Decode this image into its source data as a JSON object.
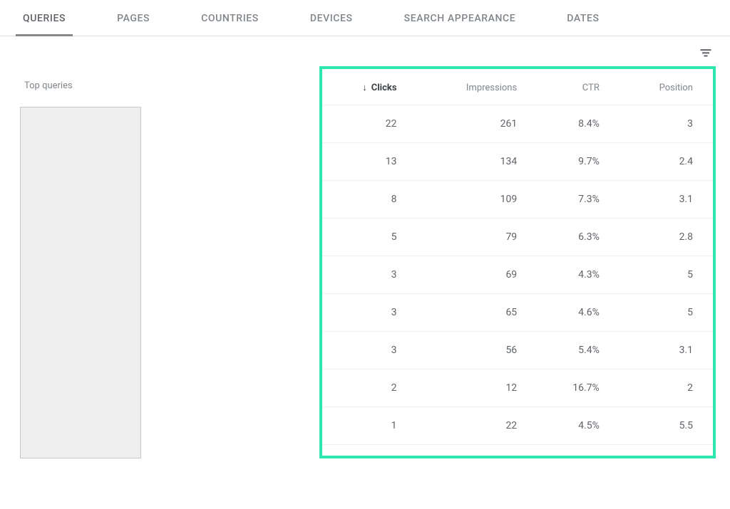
{
  "tabs": {
    "queries": "QUERIES",
    "pages": "PAGES",
    "countries": "COUNTRIES",
    "devices": "DEVICES",
    "search_appearance": "SEARCH APPEARANCE",
    "dates": "DATES"
  },
  "headers": {
    "top_queries": "Top queries",
    "clicks": "Clicks",
    "impressions": "Impressions",
    "ctr": "CTR",
    "position": "Position"
  },
  "rows": [
    {
      "clicks": "22",
      "impressions": "261",
      "ctr": "8.4%",
      "position": "3"
    },
    {
      "clicks": "13",
      "impressions": "134",
      "ctr": "9.7%",
      "position": "2.4"
    },
    {
      "clicks": "8",
      "impressions": "109",
      "ctr": "7.3%",
      "position": "3.1"
    },
    {
      "clicks": "5",
      "impressions": "79",
      "ctr": "6.3%",
      "position": "2.8"
    },
    {
      "clicks": "3",
      "impressions": "69",
      "ctr": "4.3%",
      "position": "5"
    },
    {
      "clicks": "3",
      "impressions": "65",
      "ctr": "4.6%",
      "position": "5"
    },
    {
      "clicks": "3",
      "impressions": "56",
      "ctr": "5.4%",
      "position": "3.1"
    },
    {
      "clicks": "2",
      "impressions": "12",
      "ctr": "16.7%",
      "position": "2"
    },
    {
      "clicks": "1",
      "impressions": "22",
      "ctr": "4.5%",
      "position": "5.5"
    }
  ]
}
